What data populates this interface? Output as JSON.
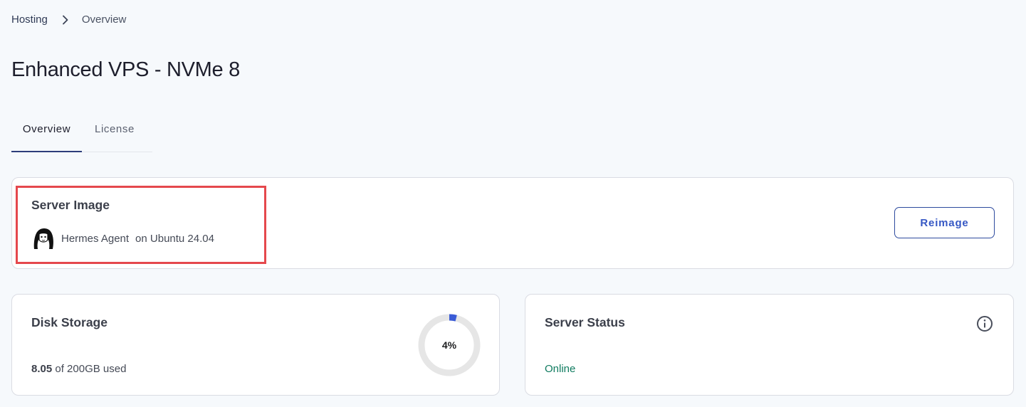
{
  "breadcrumb": {
    "root": "Hosting",
    "current": "Overview"
  },
  "page": {
    "title": "Enhanced VPS - NVMe 8"
  },
  "tabs": [
    {
      "label": "Overview",
      "active": true
    },
    {
      "label": "License",
      "active": false
    }
  ],
  "server_image": {
    "title": "Server Image",
    "os_logo": "hermes-agent-logo",
    "app_name": "Hermes Agent",
    "os_label": "on Ubuntu 24.04",
    "reimage_label": "Reimage"
  },
  "disk_storage": {
    "title": "Disk Storage",
    "used": "8.05",
    "total_text": "of 200GB used",
    "percent": 4,
    "percent_label": "4%",
    "ring_color": "#3a5bd6",
    "track_color": "#e6e6e6"
  },
  "server_status": {
    "title": "Server Status",
    "status": "Online",
    "status_color": "#0f7b5f",
    "info_icon": "info-icon"
  }
}
